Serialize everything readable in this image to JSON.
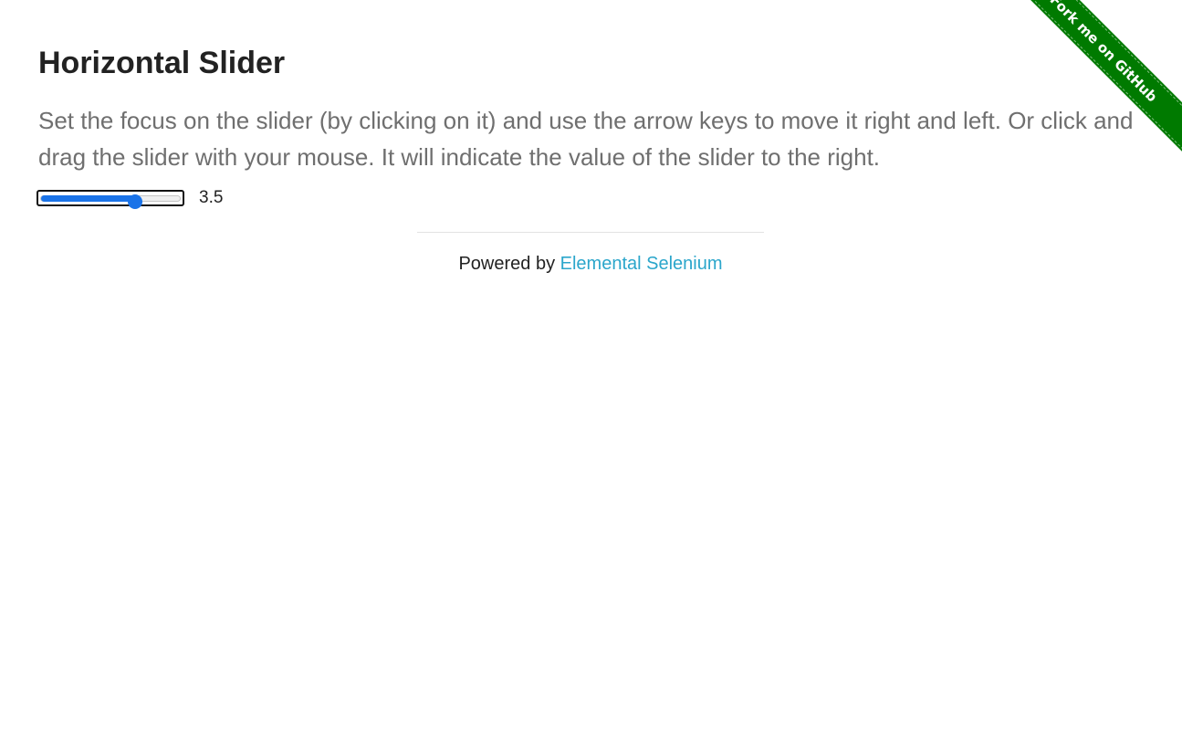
{
  "page": {
    "title": "Horizontal Slider",
    "description": "Set the focus on the slider (by clicking on it) and use the arrow keys to move it right and left. Or click and drag the slider with your mouse. It will indicate the value of the slider to the right."
  },
  "slider": {
    "value": "3.5",
    "min": 0,
    "max": 5,
    "accent_color": "#1a73e8"
  },
  "footer": {
    "prefix": "Powered by",
    "link_text": "Elemental Selenium"
  },
  "ribbon": {
    "text": "Fork me on GitHub",
    "color": "#007a00"
  }
}
